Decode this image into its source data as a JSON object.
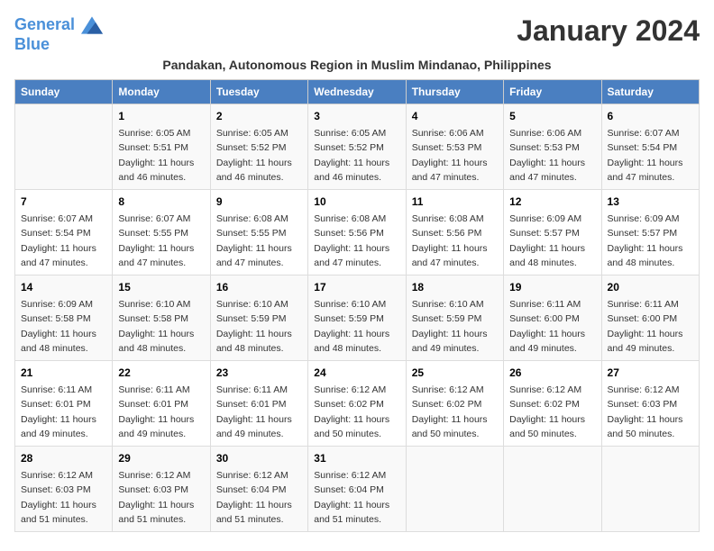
{
  "logo": {
    "line1": "General",
    "line2": "Blue"
  },
  "title": "January 2024",
  "subtitle": "Pandakan, Autonomous Region in Muslim Mindanao, Philippines",
  "headers": [
    "Sunday",
    "Monday",
    "Tuesday",
    "Wednesday",
    "Thursday",
    "Friday",
    "Saturday"
  ],
  "weeks": [
    [
      {
        "day": "",
        "sunrise": "",
        "sunset": "",
        "daylight": ""
      },
      {
        "day": "1",
        "sunrise": "6:05 AM",
        "sunset": "5:51 PM",
        "daylight": "11 hours and 46 minutes."
      },
      {
        "day": "2",
        "sunrise": "6:05 AM",
        "sunset": "5:52 PM",
        "daylight": "11 hours and 46 minutes."
      },
      {
        "day": "3",
        "sunrise": "6:05 AM",
        "sunset": "5:52 PM",
        "daylight": "11 hours and 46 minutes."
      },
      {
        "day": "4",
        "sunrise": "6:06 AM",
        "sunset": "5:53 PM",
        "daylight": "11 hours and 47 minutes."
      },
      {
        "day": "5",
        "sunrise": "6:06 AM",
        "sunset": "5:53 PM",
        "daylight": "11 hours and 47 minutes."
      },
      {
        "day": "6",
        "sunrise": "6:07 AM",
        "sunset": "5:54 PM",
        "daylight": "11 hours and 47 minutes."
      }
    ],
    [
      {
        "day": "7",
        "sunrise": "6:07 AM",
        "sunset": "5:54 PM",
        "daylight": "11 hours and 47 minutes."
      },
      {
        "day": "8",
        "sunrise": "6:07 AM",
        "sunset": "5:55 PM",
        "daylight": "11 hours and 47 minutes."
      },
      {
        "day": "9",
        "sunrise": "6:08 AM",
        "sunset": "5:55 PM",
        "daylight": "11 hours and 47 minutes."
      },
      {
        "day": "10",
        "sunrise": "6:08 AM",
        "sunset": "5:56 PM",
        "daylight": "11 hours and 47 minutes."
      },
      {
        "day": "11",
        "sunrise": "6:08 AM",
        "sunset": "5:56 PM",
        "daylight": "11 hours and 47 minutes."
      },
      {
        "day": "12",
        "sunrise": "6:09 AM",
        "sunset": "5:57 PM",
        "daylight": "11 hours and 48 minutes."
      },
      {
        "day": "13",
        "sunrise": "6:09 AM",
        "sunset": "5:57 PM",
        "daylight": "11 hours and 48 minutes."
      }
    ],
    [
      {
        "day": "14",
        "sunrise": "6:09 AM",
        "sunset": "5:58 PM",
        "daylight": "11 hours and 48 minutes."
      },
      {
        "day": "15",
        "sunrise": "6:10 AM",
        "sunset": "5:58 PM",
        "daylight": "11 hours and 48 minutes."
      },
      {
        "day": "16",
        "sunrise": "6:10 AM",
        "sunset": "5:59 PM",
        "daylight": "11 hours and 48 minutes."
      },
      {
        "day": "17",
        "sunrise": "6:10 AM",
        "sunset": "5:59 PM",
        "daylight": "11 hours and 48 minutes."
      },
      {
        "day": "18",
        "sunrise": "6:10 AM",
        "sunset": "5:59 PM",
        "daylight": "11 hours and 49 minutes."
      },
      {
        "day": "19",
        "sunrise": "6:11 AM",
        "sunset": "6:00 PM",
        "daylight": "11 hours and 49 minutes."
      },
      {
        "day": "20",
        "sunrise": "6:11 AM",
        "sunset": "6:00 PM",
        "daylight": "11 hours and 49 minutes."
      }
    ],
    [
      {
        "day": "21",
        "sunrise": "6:11 AM",
        "sunset": "6:01 PM",
        "daylight": "11 hours and 49 minutes."
      },
      {
        "day": "22",
        "sunrise": "6:11 AM",
        "sunset": "6:01 PM",
        "daylight": "11 hours and 49 minutes."
      },
      {
        "day": "23",
        "sunrise": "6:11 AM",
        "sunset": "6:01 PM",
        "daylight": "11 hours and 49 minutes."
      },
      {
        "day": "24",
        "sunrise": "6:12 AM",
        "sunset": "6:02 PM",
        "daylight": "11 hours and 50 minutes."
      },
      {
        "day": "25",
        "sunrise": "6:12 AM",
        "sunset": "6:02 PM",
        "daylight": "11 hours and 50 minutes."
      },
      {
        "day": "26",
        "sunrise": "6:12 AM",
        "sunset": "6:02 PM",
        "daylight": "11 hours and 50 minutes."
      },
      {
        "day": "27",
        "sunrise": "6:12 AM",
        "sunset": "6:03 PM",
        "daylight": "11 hours and 50 minutes."
      }
    ],
    [
      {
        "day": "28",
        "sunrise": "6:12 AM",
        "sunset": "6:03 PM",
        "daylight": "11 hours and 51 minutes."
      },
      {
        "day": "29",
        "sunrise": "6:12 AM",
        "sunset": "6:03 PM",
        "daylight": "11 hours and 51 minutes."
      },
      {
        "day": "30",
        "sunrise": "6:12 AM",
        "sunset": "6:04 PM",
        "daylight": "11 hours and 51 minutes."
      },
      {
        "day": "31",
        "sunrise": "6:12 AM",
        "sunset": "6:04 PM",
        "daylight": "11 hours and 51 minutes."
      },
      {
        "day": "",
        "sunrise": "",
        "sunset": "",
        "daylight": ""
      },
      {
        "day": "",
        "sunrise": "",
        "sunset": "",
        "daylight": ""
      },
      {
        "day": "",
        "sunrise": "",
        "sunset": "",
        "daylight": ""
      }
    ]
  ],
  "labels": {
    "sunrise_prefix": "Sunrise: ",
    "sunset_prefix": "Sunset: ",
    "daylight_prefix": "Daylight: "
  }
}
